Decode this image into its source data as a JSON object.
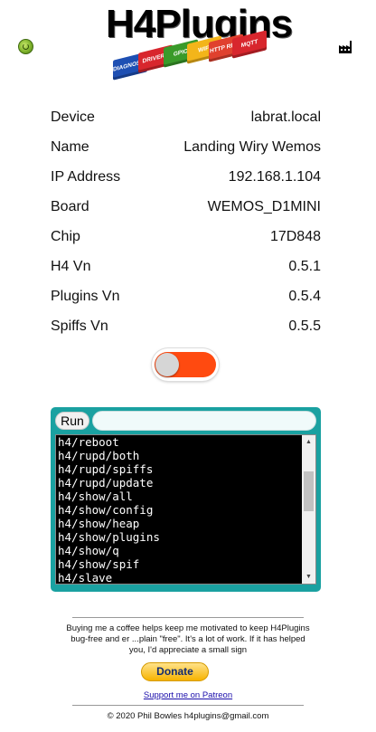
{
  "header": {
    "logo_text": "H4Plugins",
    "logo_bricks": [
      "DIAGNOSTICS",
      "DRIVERS",
      "GPIO",
      "WIFI",
      "HTTP REST",
      "MQTT"
    ],
    "brick_colors": [
      "#1e4fb3",
      "#d8262d",
      "#3a9a2a",
      "#f3b51a",
      "#e0412e",
      "#d8262d"
    ],
    "status_icon": "connected-status-icon",
    "factory_icon": "factory-reset-icon"
  },
  "info": {
    "rows": [
      {
        "label": "Device",
        "value": "labrat.local"
      },
      {
        "label": "Name",
        "value": "Landing Wiry Wemos"
      },
      {
        "label": "IP Address",
        "value": "192.168.1.104"
      },
      {
        "label": "Board",
        "value": "WEMOS_D1MINI"
      },
      {
        "label": "Chip",
        "value": "17D848"
      },
      {
        "label": "H4 Vn",
        "value": "0.5.1"
      },
      {
        "label": "Plugins Vn",
        "value": "0.5.4"
      },
      {
        "label": "Spiffs Vn",
        "value": "0.5.5"
      }
    ]
  },
  "toggle": {
    "state": "off",
    "track_color": "#ff4a10"
  },
  "console": {
    "run_label": "Run",
    "input_value": "",
    "output_lines": [
      "h4/reboot",
      "h4/rupd/both",
      "h4/rupd/spiffs",
      "h4/rupd/update",
      "h4/show/all",
      "h4/show/config",
      "h4/show/heap",
      "h4/show/plugins",
      "h4/show/q",
      "h4/show/spif",
      "h4/slave"
    ],
    "accent_color": "#1aa1a1"
  },
  "footer": {
    "donate_text": "Buying me a coffee helps keep me motivated to keep H4Plugins bug-free and er ...plain \"free\". It's a lot of work. If it has helped you, I'd appreciate a small sign",
    "donate_label": "Donate",
    "patreon_label": "Support me on Patreon",
    "copyright": "© 2020 Phil Bowles h4plugins@gmail.com"
  }
}
